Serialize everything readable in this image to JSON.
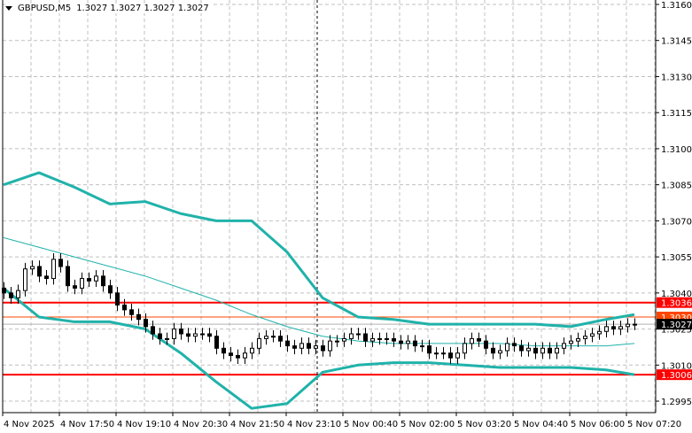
{
  "header": {
    "symbol": "GBPUSD,M5",
    "ohlc": "1.3027 1.3027 1.3027 1.3027"
  },
  "colors": {
    "band": "#20b2aa",
    "level": "#ff0000",
    "ask": "#ff4500",
    "bid": "#000000",
    "grid": "#c0c0c0"
  },
  "chart_data": {
    "type": "candlestick",
    "title": "GBPUSD,M5",
    "ylim": [
      1.299,
      1.3162
    ],
    "yticks": [
      "1.3160",
      "1.3145",
      "1.3130",
      "1.3115",
      "1.3100",
      "1.3085",
      "1.3070",
      "1.3055",
      "1.3040",
      "1.3025",
      "1.3010",
      "1.2995"
    ],
    "xticks": [
      "4 Nov 2025",
      "4 Nov 17:50",
      "4 Nov 19:10",
      "4 Nov 20:30",
      "4 Nov 21:50",
      "4 Nov 23:10",
      "5 Nov 00:40",
      "5 Nov 02:00",
      "5 Nov 03:20",
      "5 Nov 04:40",
      "5 Nov 06:00",
      "5 Nov 07:20"
    ],
    "closes": [
      1.304,
      1.3038,
      1.3041,
      1.305,
      1.3051,
      1.3047,
      1.3046,
      1.3054,
      1.3051,
      1.3043,
      1.3042,
      1.3046,
      1.3045,
      1.3047,
      1.3043,
      1.304,
      1.3035,
      1.3033,
      1.3031,
      1.3029,
      1.3026,
      1.3023,
      1.3021,
      1.3021,
      1.3025,
      1.3023,
      1.3022,
      1.3023,
      1.3023,
      1.3022,
      1.3017,
      1.3015,
      1.3014,
      1.3013,
      1.3015,
      1.3017,
      1.3021,
      1.3022,
      1.3022,
      1.302,
      1.3018,
      1.3017,
      1.3019,
      1.3017,
      1.3018,
      1.3016,
      1.302,
      1.302,
      1.3021,
      1.3023,
      1.3023,
      1.302,
      1.3021,
      1.3021,
      1.3021,
      1.302,
      1.3019,
      1.302,
      1.3018,
      1.3018,
      1.3015,
      1.3015,
      1.3015,
      1.3013,
      1.3015,
      1.3019,
      1.3021,
      1.302,
      1.3017,
      1.3015,
      1.3016,
      1.3019,
      1.3018,
      1.3016,
      1.3017,
      1.3015,
      1.3017,
      1.3015,
      1.3017,
      1.3019,
      1.302,
      1.3021,
      1.3022,
      1.3023,
      1.3024,
      1.3026,
      1.3025,
      1.3026,
      1.3027,
      1.3027
    ],
    "bollinger": {
      "index": [
        0,
        5,
        10,
        15,
        20,
        25,
        30,
        35,
        40,
        45,
        50,
        55,
        60,
        65,
        70,
        75,
        80,
        85,
        89
      ],
      "upper": [
        1.3085,
        1.309,
        1.3084,
        1.3077,
        1.3078,
        1.3073,
        1.307,
        1.307,
        1.3057,
        1.3038,
        1.303,
        1.3029,
        1.3027,
        1.3027,
        1.3027,
        1.3027,
        1.3026,
        1.3029,
        1.3031
      ],
      "middle": [
        1.3063,
        1.3059,
        1.3055,
        1.3051,
        1.3047,
        1.3042,
        1.3037,
        1.3031,
        1.3026,
        1.3022,
        1.302,
        1.3019,
        1.3019,
        1.3019,
        1.3019,
        1.3018,
        1.3018,
        1.3018,
        1.3019
      ],
      "lower": [
        1.3042,
        1.303,
        1.3028,
        1.3028,
        1.3025,
        1.3015,
        1.3003,
        1.2992,
        1.2994,
        1.3007,
        1.301,
        1.3011,
        1.3011,
        1.301,
        1.3009,
        1.3009,
        1.3009,
        1.3008,
        1.3006
      ]
    },
    "levels": [
      {
        "price": 1.3036,
        "label": "1.3036",
        "kind": "level"
      },
      {
        "price": 1.303,
        "label": "1.3030",
        "kind": "ask"
      },
      {
        "price": 1.3027,
        "label": "1.3027",
        "kind": "bid"
      },
      {
        "price": 1.3006,
        "label": "1.3006",
        "kind": "level"
      }
    ],
    "crosshair_x_index": 44
  }
}
